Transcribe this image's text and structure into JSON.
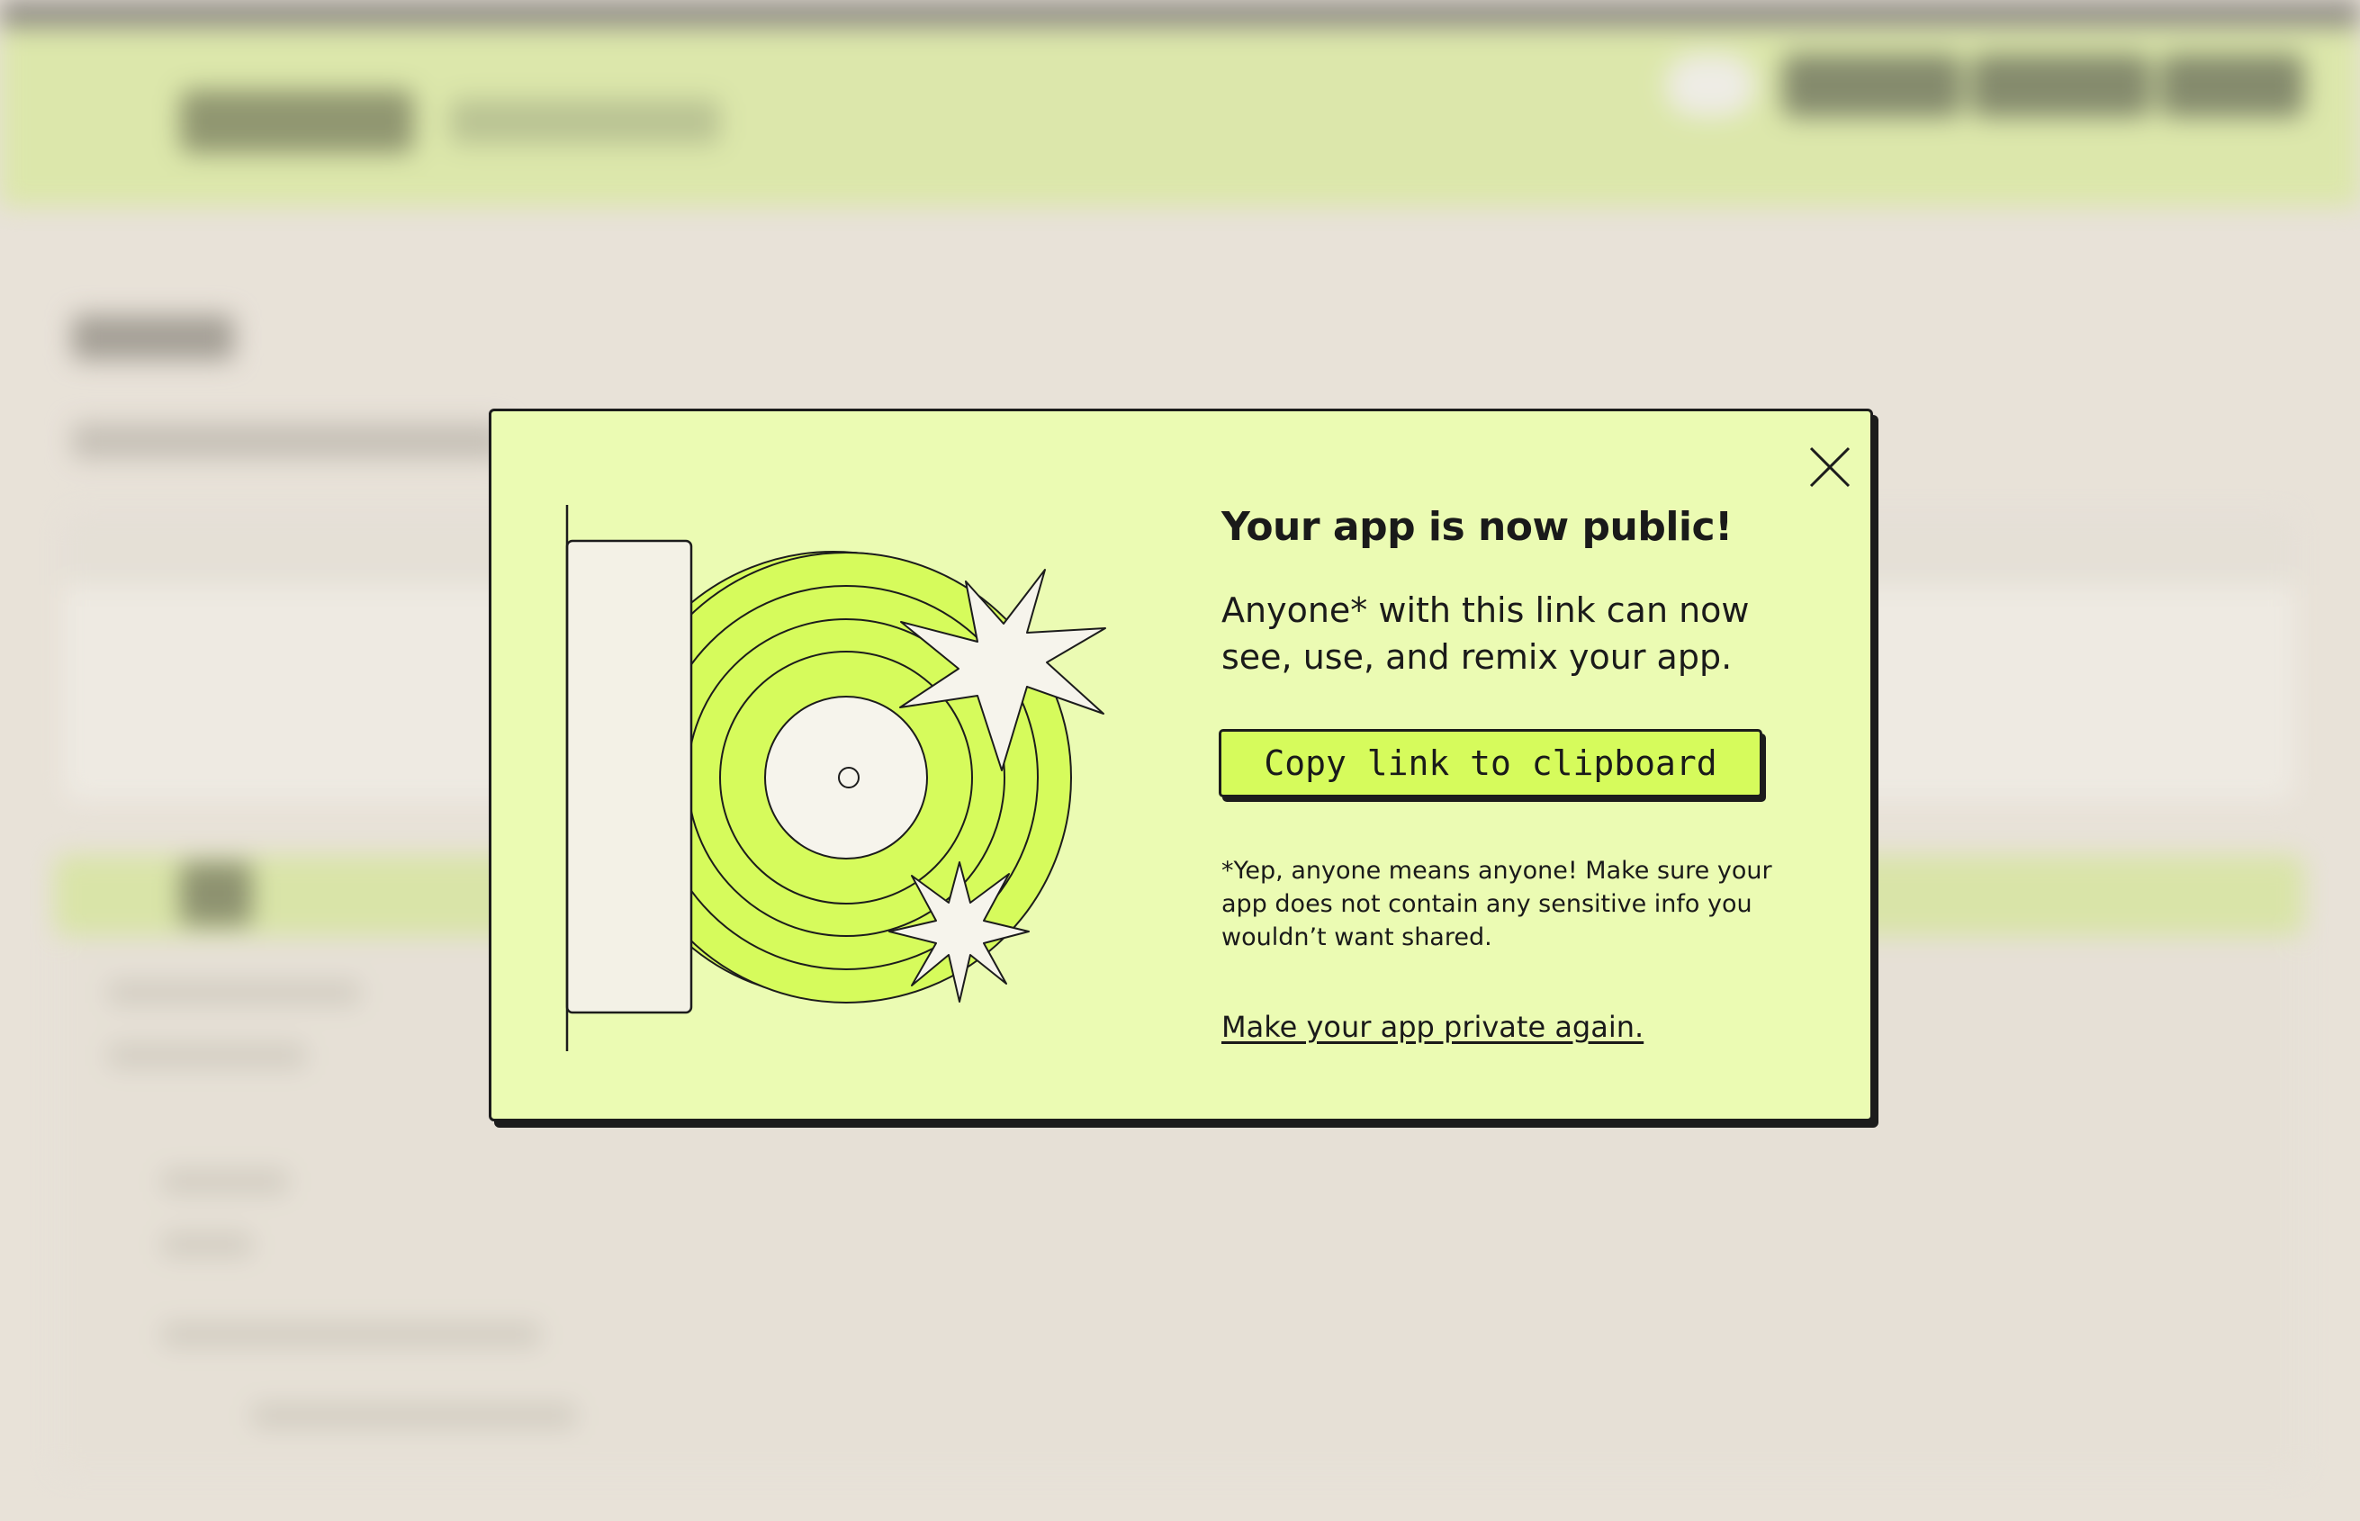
{
  "modal": {
    "title": "Your app is now public!",
    "body": "Anyone* with this link can now see, use, and remix your app.",
    "copy_button_label": "Copy link to clipboard",
    "footnote": "*Yep, anyone means anyone! Make sure your app does not contain any sensitive info you wouldn’t want shared.",
    "private_link_label": "Make your app private again.",
    "close_icon": "close-icon"
  },
  "colors": {
    "modal_background": "#ebfbb3",
    "accent_lime": "#d6fb5c",
    "outline": "#1c1c1c",
    "page_background": "#e8e2d9",
    "header_background": "#d7e99a",
    "star_fill": "#f6f4ec"
  },
  "illustration": {
    "name": "record-player-illustration",
    "elements": [
      "record-sleeve",
      "vinyl-record",
      "sparkle-stars"
    ]
  }
}
